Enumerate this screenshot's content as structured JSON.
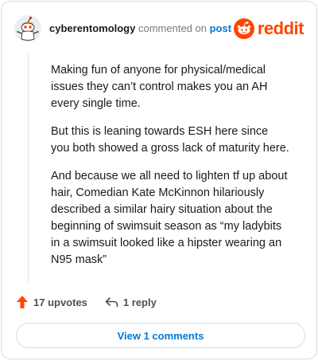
{
  "header": {
    "username": "cyberentomology",
    "action_text": "commented on",
    "post_link": "post",
    "brand": "reddit"
  },
  "comment": {
    "paragraphs": [
      "Making fun of anyone for physical/medical issues they can’t control makes you an AH every single time.",
      "But this is leaning towards ESH here since you both showed a gross lack of maturity here.",
      "And because we all need to lighten tf up about hair, Comedian Kate McKinnon hilariously described a similar hairy situation about the beginning of swimsuit season as “my ladybits in a swimsuit looked like a hipster wearing an N95 mask”"
    ]
  },
  "actions": {
    "upvotes": "17 upvotes",
    "replies": "1 reply"
  },
  "footer": {
    "view_comments": "View 1 comments"
  },
  "colors": {
    "accent": "#ff4500",
    "link": "#0079d3",
    "muted": "#787c7e"
  },
  "icons": [
    "avatar-snoo",
    "reddit-logo-icon",
    "upvote-arrow-icon",
    "reply-icon"
  ]
}
